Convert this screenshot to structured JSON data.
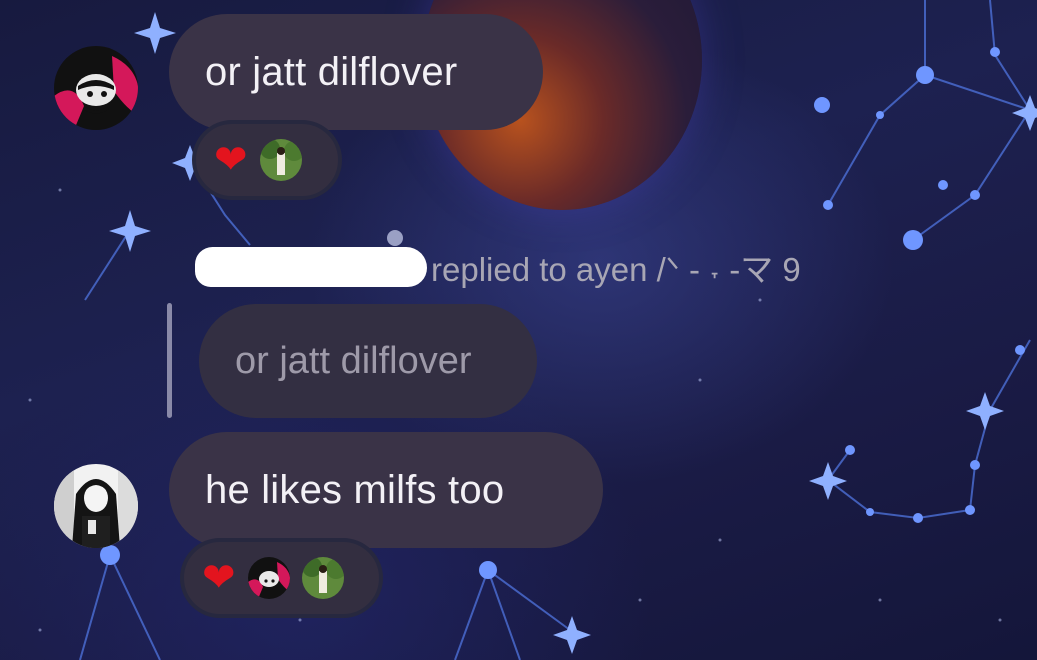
{
  "messages": [
    {
      "text": "or jatt dilflover",
      "reactions": {
        "emoji": "❤",
        "reactor_avatars": [
          "avatar-girl-green"
        ]
      }
    },
    {
      "reply_meta": {
        "suffix": "replied to ayen /ᐠ - ˕ -マ 9"
      },
      "quoted_text": "or jatt dilflover",
      "text": "he likes milfs too",
      "reactions": {
        "emoji": "❤",
        "reactor_avatars": [
          "avatar-pink-art",
          "avatar-girl-green"
        ]
      }
    }
  ],
  "colors": {
    "bubble": "#3a3347",
    "reply_bubble": "#332f42",
    "background": "#1d2150",
    "heart": "#e3141e"
  }
}
